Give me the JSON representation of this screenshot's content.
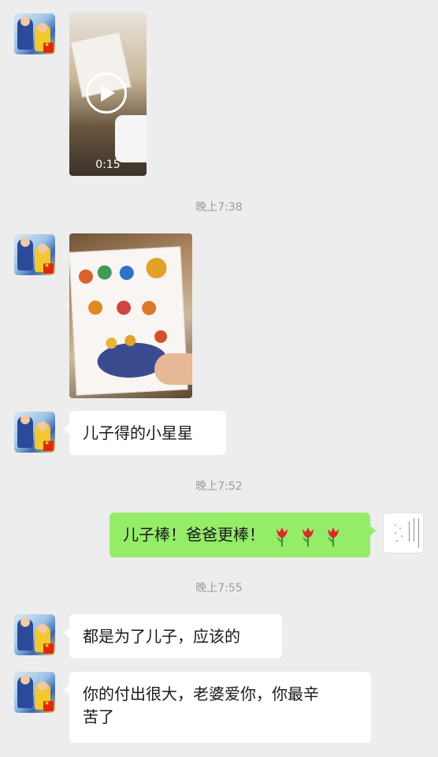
{
  "messages": {
    "video": {
      "duration": "0:15"
    },
    "time1": "晚上7:38",
    "text1": "儿子得的小星星",
    "time2": "晚上7:52",
    "my_text": "儿子棒！爸爸更棒！",
    "time3": "晚上7:55",
    "text2": "都是为了儿子，应该的",
    "text3_line1": "你的付出很大，老婆爱你，你最辛",
    "text3_line2": "苦了"
  },
  "colors": {
    "background": "#ededed",
    "incoming_bubble": "#ffffff",
    "outgoing_bubble": "#95ec69",
    "timestamp": "#9a9a9a"
  },
  "icons": [
    "play-icon",
    "tulip-emoji",
    "china-flag-badge"
  ]
}
